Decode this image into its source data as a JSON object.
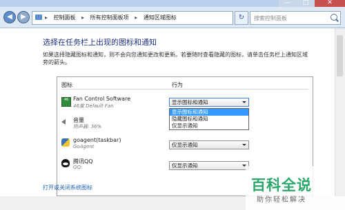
{
  "window": {
    "minimize": "—",
    "maximize": "□",
    "close": "✕"
  },
  "nav": {
    "back": "◀",
    "forward": "▶"
  },
  "breadcrumb": [
    "控制面板",
    "所有控制面板项",
    "通知区域图标"
  ],
  "search": {
    "placeholder": "搜索控制面板"
  },
  "heading": "选择在任务栏上出现的图标和通知",
  "description": "如果选择隐藏图标和通知，则不会向您通知更改和更新。若要随时查看隐藏的图标，请单击任务栏上通知区域旁的箭头。",
  "columns": {
    "icon": "图标",
    "behavior": "行为"
  },
  "rows": [
    {
      "name": "Fan Control Software",
      "sub": "46度 Default Fan",
      "behavior": "显示图标和通知",
      "icon": "fan-icon"
    },
    {
      "name": "音量",
      "sub": "扬声器: 36%",
      "behavior": "",
      "icon": "speaker-icon"
    },
    {
      "name": "goagent(taskbar)",
      "sub": "GoAgent",
      "behavior": "仅显示通知",
      "icon": "python-icon"
    },
    {
      "name": "腾讯QQ",
      "sub": "QQ:",
      "behavior": "仅显示通知",
      "icon": "qq-icon"
    }
  ],
  "dropdown_options": [
    "显示图标和通知",
    "隐藏图标和通知",
    "仅显示通知"
  ],
  "link": "打开或关闭系统图标",
  "watermark": {
    "logo": "百科全说",
    "sub": "助你轻松解决"
  },
  "colors": {
    "heading": "#1e3287",
    "selection": "#3399ff",
    "link": "#1a5fb4",
    "watermark": "#2aa66a"
  }
}
